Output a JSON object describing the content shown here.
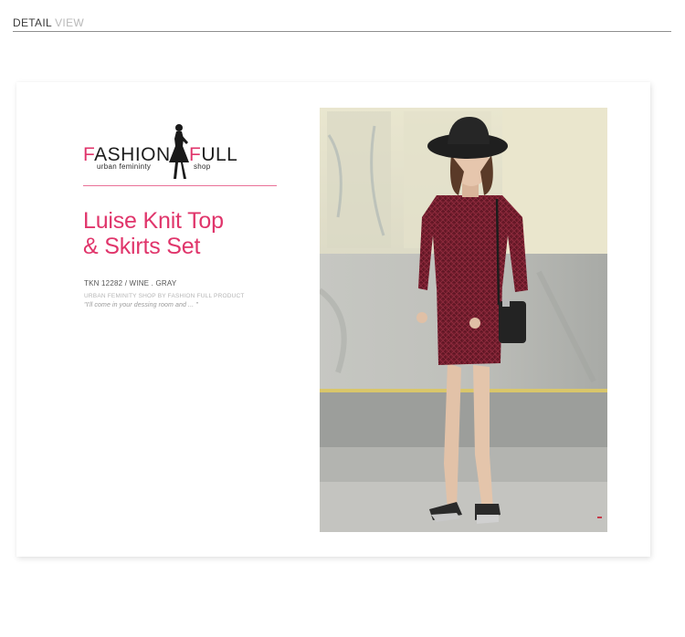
{
  "header": {
    "label_strong": "DETAIL",
    "label_light": "VIEW"
  },
  "brand": {
    "word_left_first": "F",
    "word_left_rest": "ASHION",
    "word_right_first": "F",
    "word_right_rest": "ULL",
    "tagline_left": "urban femininty",
    "tagline_right": "shop",
    "accent_color": "#e0356b"
  },
  "product": {
    "title_line1": "Luise Knit Top",
    "title_line2": "& Skirts Set",
    "code": "TKN 12282 / WINE . GRAY",
    "credit": "URBAN FEMINITY SHOP BY  FASHION FULL PRODUCT",
    "quote": "\"I'll come in your dessing room and ... \""
  },
  "photo": {
    "subject": "model-wearing-knit-set-photo",
    "colors": {
      "knit": "#6e1b2a",
      "wall_top": "#e6e2c8",
      "wall_bottom": "#c9cac6",
      "pavement": "#a9aaa7"
    }
  }
}
